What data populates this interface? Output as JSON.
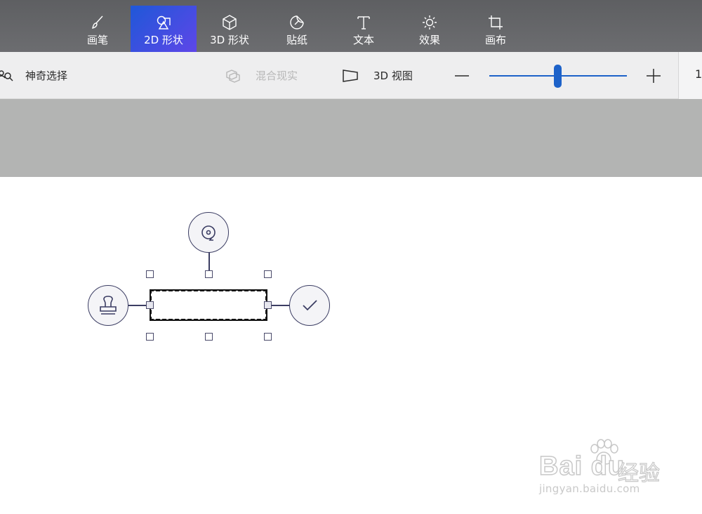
{
  "toolbar": {
    "tools": [
      {
        "label": "画笔",
        "icon": "brush-icon"
      },
      {
        "label": "2D 形状",
        "icon": "2d-shapes-icon",
        "active": true
      },
      {
        "label": "3D 形状",
        "icon": "3d-shapes-icon"
      },
      {
        "label": "贴纸",
        "icon": "sticker-icon"
      },
      {
        "label": "文本",
        "icon": "text-icon"
      },
      {
        "label": "效果",
        "icon": "effects-icon"
      },
      {
        "label": "画布",
        "icon": "canvas-icon"
      }
    ]
  },
  "commandbar": {
    "magic_select": "神奇选择",
    "mixed_reality": "混合现实",
    "view_3d": "3D 视图",
    "zoom_value_visible": "1",
    "zoom_level_fraction": 0.49
  },
  "colors": {
    "toolbar_bg": "#5e5f62",
    "active_tool_gradient": [
      "#1f58d8",
      "#5e46e8"
    ],
    "accent": "#1d62c9",
    "gray_area": "#b3b4b3",
    "handle_outline": "#3b3d63"
  },
  "selection": {
    "rotate": "rotate-icon",
    "stamp": "stamp-icon",
    "confirm": "checkmark-icon"
  },
  "watermark": {
    "logo": "Bai du",
    "cn": "经验",
    "url": "jingyan.baidu.com"
  }
}
